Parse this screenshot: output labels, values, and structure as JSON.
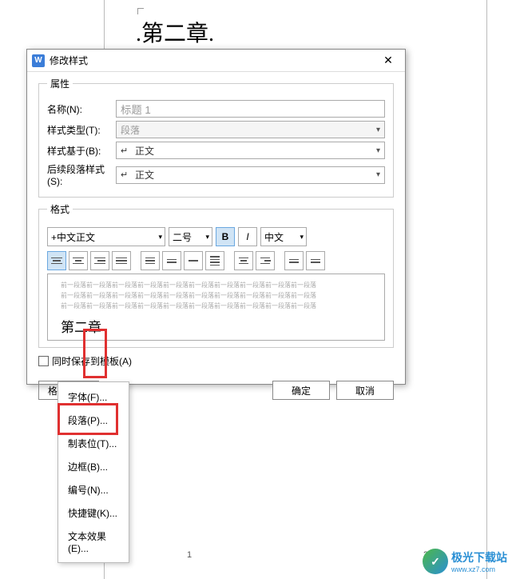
{
  "doc": {
    "heading": ".第二章."
  },
  "dialog": {
    "title": "修改样式",
    "icon_letter": "W",
    "close": "✕",
    "groups": {
      "props": "属性",
      "format": "格式"
    },
    "props": {
      "name_label": "名称(N):",
      "name_value": "标题 1",
      "type_label": "样式类型(T):",
      "type_value": "段落",
      "based_label": "样式基于(B):",
      "based_value": "正文",
      "next_label": "后续段落样式(S):",
      "next_value": "正文"
    },
    "format": {
      "font": "+中文正文",
      "size": "二号",
      "bold": "B",
      "italic": "I",
      "lang": "中文"
    },
    "preview": {
      "para": "前一段落前一段落前一段落前一段落前一段落前一段落前一段落前一段落前一段落前一段落",
      "main": "第二章"
    },
    "save_template": "同时保存到模板(A)",
    "format_btn": "格式(O)",
    "ok": "确定",
    "cancel": "取消"
  },
  "menu": {
    "items": [
      "字体(F)...",
      "段落(P)...",
      "制表位(T)...",
      "边框(B)...",
      "编号(N)...",
      "快捷键(K)...",
      "文本效果(E)..."
    ]
  },
  "watermark": {
    "brand": "极光下载站",
    "url": "www.xz7.com"
  },
  "page": {
    "n1": "1",
    "n2": "2"
  }
}
